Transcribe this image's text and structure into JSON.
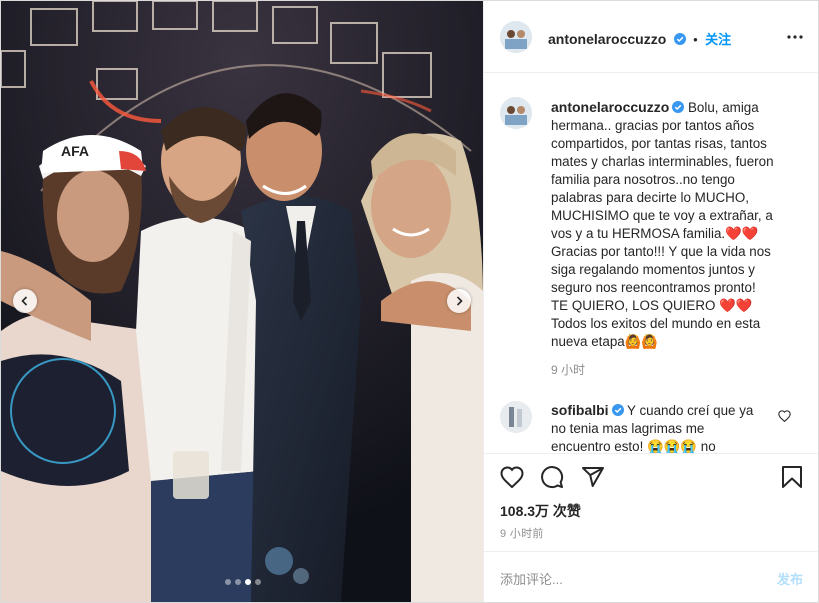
{
  "post": {
    "username": "antonelaroccuzzo",
    "follow_label": "关注",
    "separator": "•",
    "more_icon": "more-horizontal-icon",
    "caption": {
      "username": "antonelaroccuzzo",
      "lines": [
        "Bolu, amiga",
        "hermana.. gracias por tantos años",
        "compartidos, por tantas risas, tantos",
        "mates y charlas interminables, fueron",
        "familia para nosotros..no tengo",
        "palabras para decirte lo MUCHO,",
        "MUCHISIMO que te voy a extrañar, a",
        "vos y a tu HERMOSA familia.❤️❤️",
        "Gracias por tanto!!! Y que la vida nos",
        "siga regalando momentos juntos y",
        "seguro nos reencontramos pronto!",
        "TE QUIERO, LOS QUIERO ❤️❤️",
        "Todos los exitos del mundo en esta",
        "nueva etapa🙆🙆"
      ],
      "time": "9 小时"
    },
    "comment": {
      "username": "sofibalbi",
      "lines": [
        "Y cuando creí que ya",
        "no tenia mas lagrimas me",
        "encuentro esto! 😭😭😭 no"
      ]
    },
    "likes": "108.3万 次赞",
    "timestamp": "9 小时前",
    "add_comment_placeholder": "添加评论...",
    "post_label": "发布",
    "carousel": {
      "total": 4,
      "active_index": 2
    }
  },
  "colors": {
    "link_blue": "#0095f6",
    "verified_blue": "#3897f0",
    "muted": "#8e8e8e",
    "post_disabled": "#b2dffc"
  }
}
